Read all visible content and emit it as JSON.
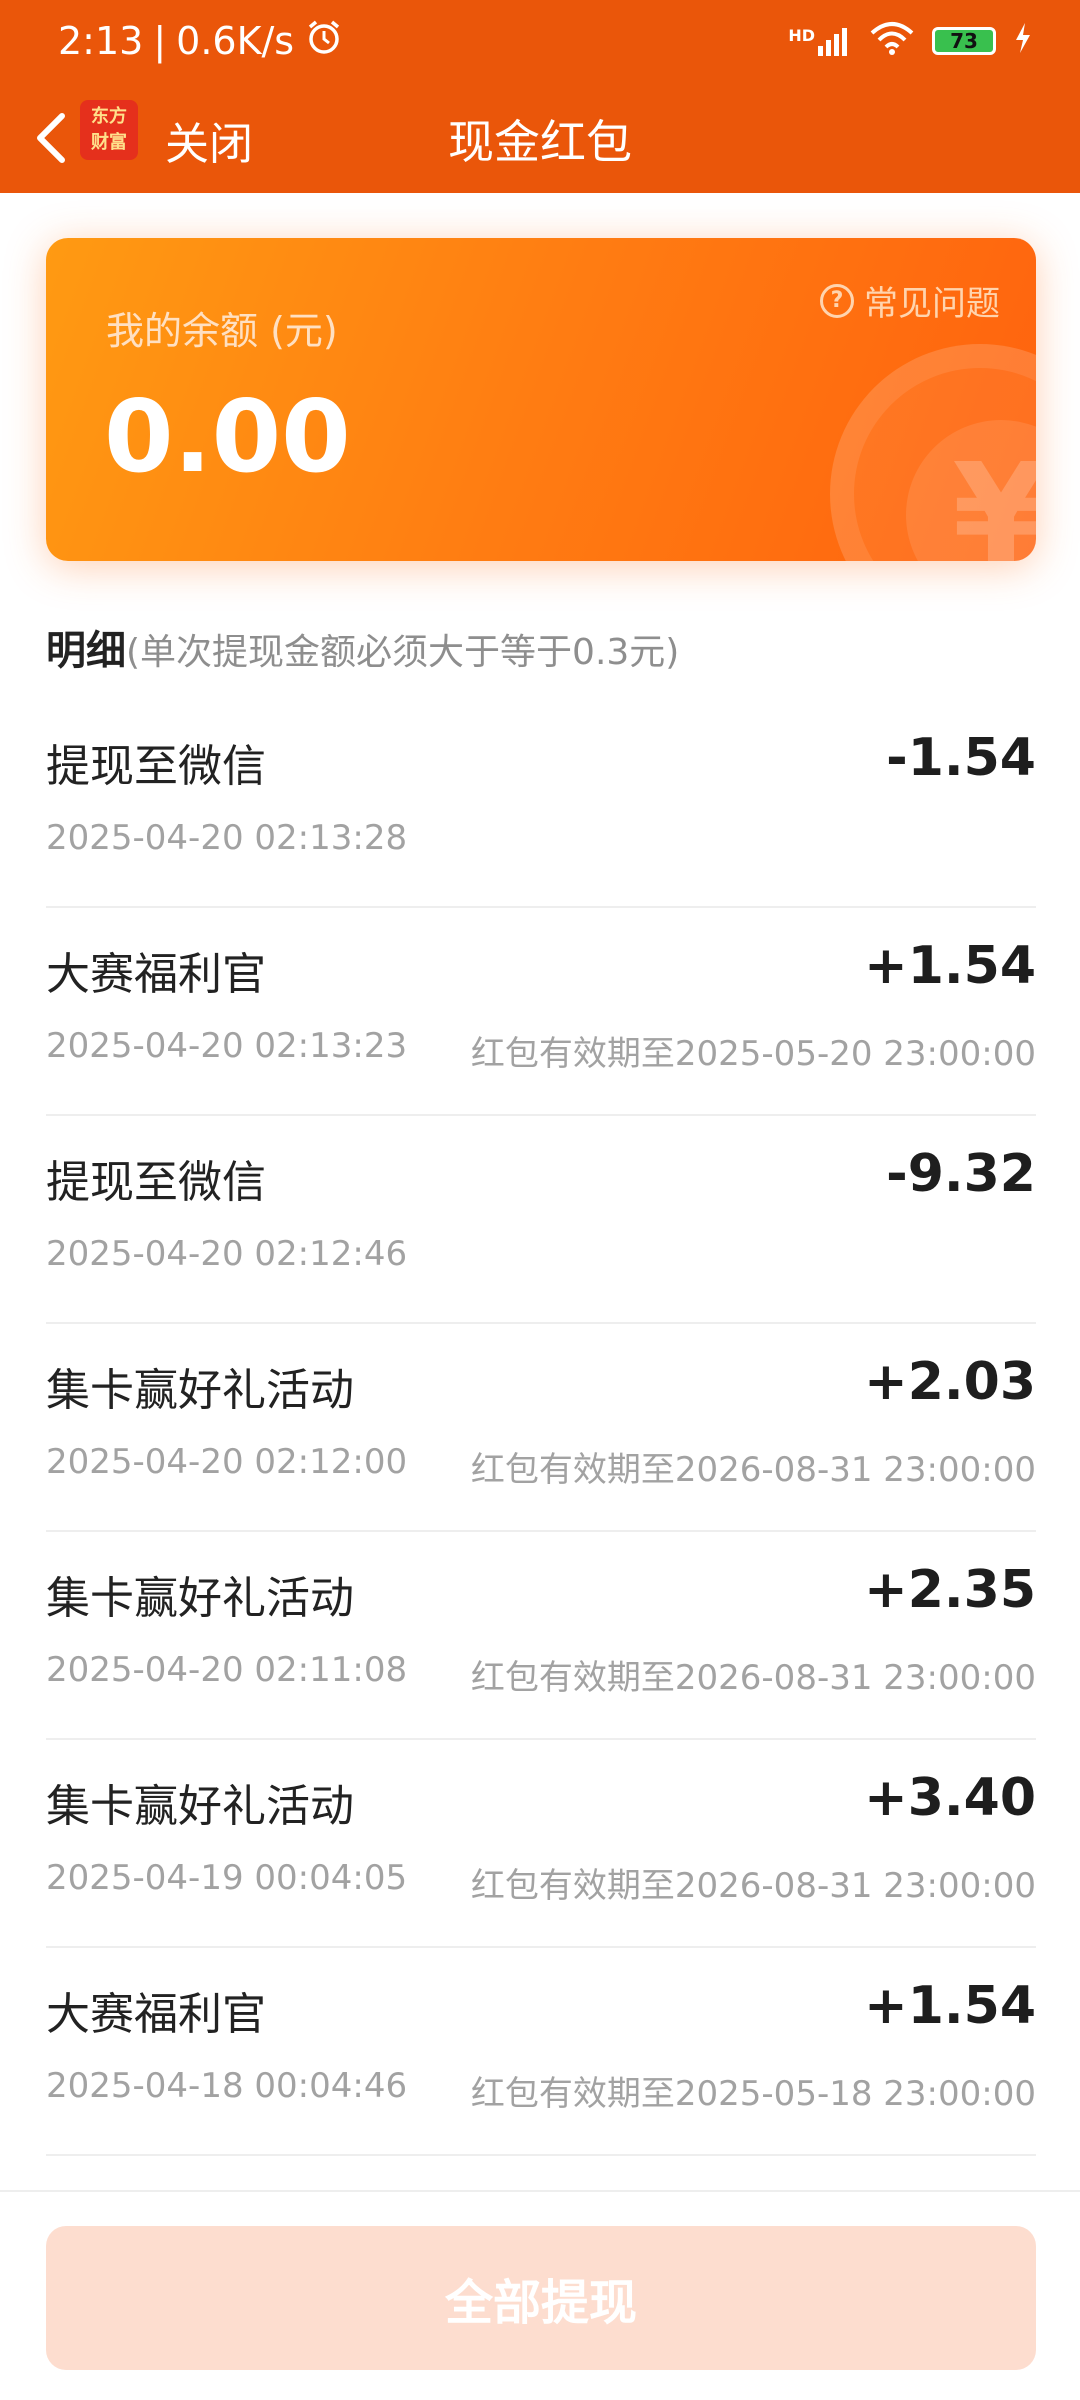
{
  "status_bar": {
    "time": "2:13",
    "net_speed": "0.6K/s",
    "battery": "73",
    "signal": "HD"
  },
  "nav": {
    "logo_line1": "东方",
    "logo_line2": "财富",
    "close_label": "关闭",
    "title": "现金红包"
  },
  "balance": {
    "label": "我的余额 (元)",
    "amount": "0.00",
    "faq_label": "常见问题"
  },
  "details": {
    "title": "明细",
    "note": "(单次提现金额必须大于等于0.3元)"
  },
  "transactions": [
    {
      "title": "提现至微信",
      "time": "2025-04-20 02:13:28",
      "amount": "-1.54",
      "expiry": ""
    },
    {
      "title": "大赛福利官",
      "time": "2025-04-20 02:13:23",
      "amount": "+1.54",
      "expiry": "红包有效期至2025-05-20 23:00:00"
    },
    {
      "title": "提现至微信",
      "time": "2025-04-20 02:12:46",
      "amount": "-9.32",
      "expiry": ""
    },
    {
      "title": "集卡赢好礼活动",
      "time": "2025-04-20 02:12:00",
      "amount": "+2.03",
      "expiry": "红包有效期至2026-08-31 23:00:00"
    },
    {
      "title": "集卡赢好礼活动",
      "time": "2025-04-20 02:11:08",
      "amount": "+2.35",
      "expiry": "红包有效期至2026-08-31 23:00:00"
    },
    {
      "title": "集卡赢好礼活动",
      "time": "2025-04-19 00:04:05",
      "amount": "+3.40",
      "expiry": "红包有效期至2026-08-31 23:00:00"
    },
    {
      "title": "大赛福利官",
      "time": "2025-04-18 00:04:46",
      "amount": "+1.54",
      "expiry": "红包有效期至2025-05-18 23:00:00"
    }
  ],
  "footer": {
    "withdraw_all": "全部提现"
  },
  "colors": {
    "header_bg": "#EA560A",
    "card_start": "#FF9A12",
    "card_end": "#FF620E",
    "button_bg": "#FDDDCF"
  }
}
